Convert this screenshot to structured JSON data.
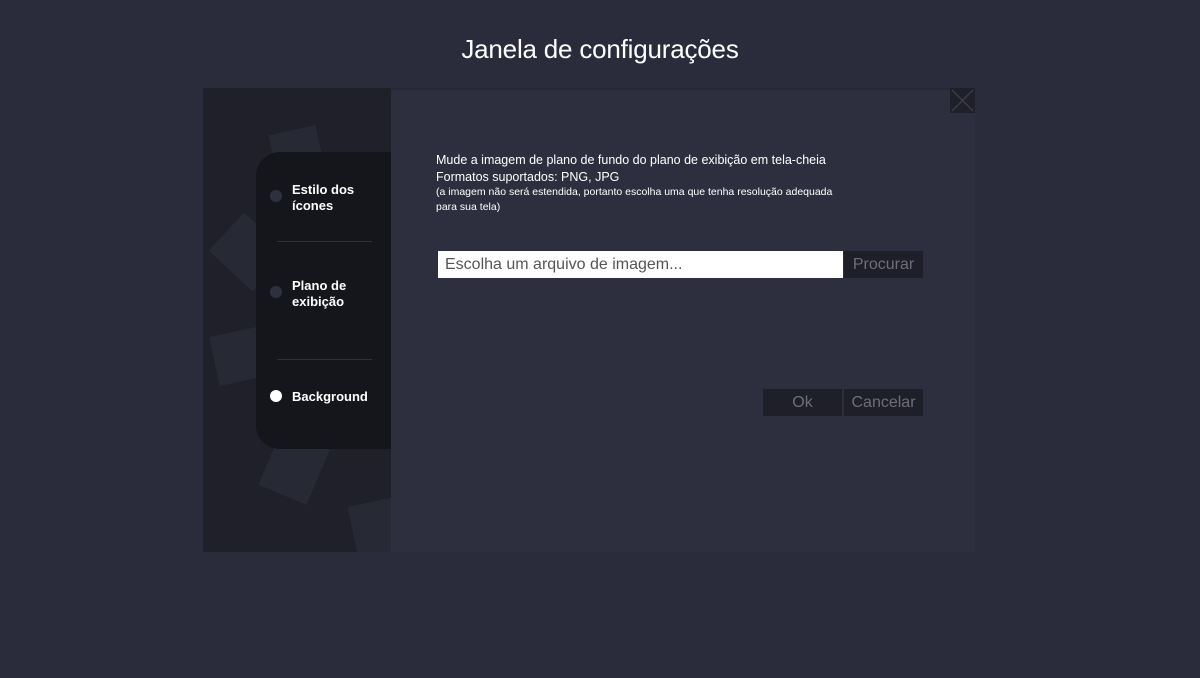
{
  "page": {
    "title": "Janela de configurações"
  },
  "sidebar": {
    "items": [
      {
        "label": "Estilo dos ícones",
        "active": false
      },
      {
        "label": "Plano de exibição",
        "active": false
      },
      {
        "label": "Background",
        "active": true
      }
    ]
  },
  "panel": {
    "description_line1": "Mude a imagem de plano de fundo do plano de exibição em tela-cheia",
    "description_line2": "Formatos suportados: PNG, JPG",
    "description_line3": "(a imagem não será estendida, portanto escolha uma que tenha resolução adequada para sua tela)",
    "file_input_placeholder": "Escolha um arquivo de imagem...",
    "browse_label": "Procurar",
    "ok_label": "Ok",
    "cancel_label": "Cancelar"
  },
  "icons": {
    "close": "close-icon",
    "gear": "gear-icon",
    "radio": "radio-dot-icon"
  },
  "colors": {
    "background": "#2a2c3b",
    "panel": "#2d2f3e",
    "sidebar": "#1f2029",
    "menu_card": "#15161b",
    "button": "#1e1f28",
    "button_text": "#6c6e7a",
    "active_dot": "#ffffff"
  }
}
